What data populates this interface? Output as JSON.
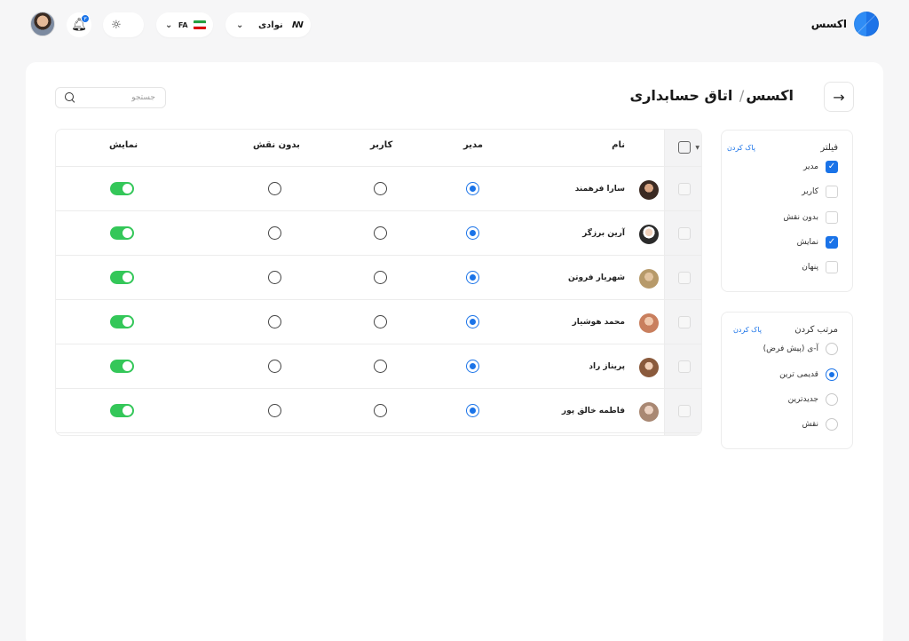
{
  "brand": {
    "name": "اکسس",
    "logo_icon": "brand-logo-icon"
  },
  "workspace": {
    "name": "نوادی",
    "logo_text": "AA",
    "chevron": "⌄"
  },
  "language": {
    "code": "FA",
    "chevron": "⌄"
  },
  "notifications": {
    "count": "۳"
  },
  "page": {
    "title_root": "اکسس",
    "title_sep": "/",
    "title_current": "اتاق حسابداری",
    "back_icon": "→"
  },
  "search": {
    "placeholder": "جستجو",
    "value": ""
  },
  "filter": {
    "title": "فیلتر",
    "clear": "پاک کردن",
    "options": [
      {
        "label": "مدیر",
        "checked": true
      },
      {
        "label": "کاربر",
        "checked": false
      },
      {
        "label": "بدون نقش",
        "checked": false
      },
      {
        "label": "نمایش",
        "checked": true
      },
      {
        "label": "پنهان",
        "checked": false
      }
    ]
  },
  "sort": {
    "title": "مرتب کردن",
    "clear": "پاک کردن",
    "options": [
      {
        "label": "آ-ی (پیش فرض)",
        "selected": false
      },
      {
        "label": "قدیمی ترین",
        "selected": true
      },
      {
        "label": "جدیدترین",
        "selected": false
      },
      {
        "label": "نقش",
        "selected": false
      }
    ]
  },
  "table": {
    "columns": {
      "name": "نام",
      "admin": "مدیر",
      "user": "کاربر",
      "no_role": "بدون نقش",
      "visible": "نمایش"
    },
    "rows": [
      {
        "name": "سارا فرهمند",
        "role": "admin",
        "visible": true,
        "avatar_color": "#3b2a22"
      },
      {
        "name": "آرین برزگر",
        "role": "admin",
        "visible": true,
        "avatar_color": "#2b2b2b"
      },
      {
        "name": "شهریار فروتن",
        "role": "admin",
        "visible": true,
        "avatar_color": "#b79a6a"
      },
      {
        "name": "محمد هوشیار",
        "role": "admin",
        "visible": true,
        "avatar_color": "#c97f5e"
      },
      {
        "name": "پریناز راد",
        "role": "admin",
        "visible": true,
        "avatar_color": "#8a5a3c"
      },
      {
        "name": "فاطمه خالق پور",
        "role": "admin",
        "visible": true,
        "avatar_color": "#a98873"
      }
    ]
  },
  "colors": {
    "accent": "#1a73e8",
    "toggle_on": "#34c759",
    "background": "#f6f6f7"
  }
}
